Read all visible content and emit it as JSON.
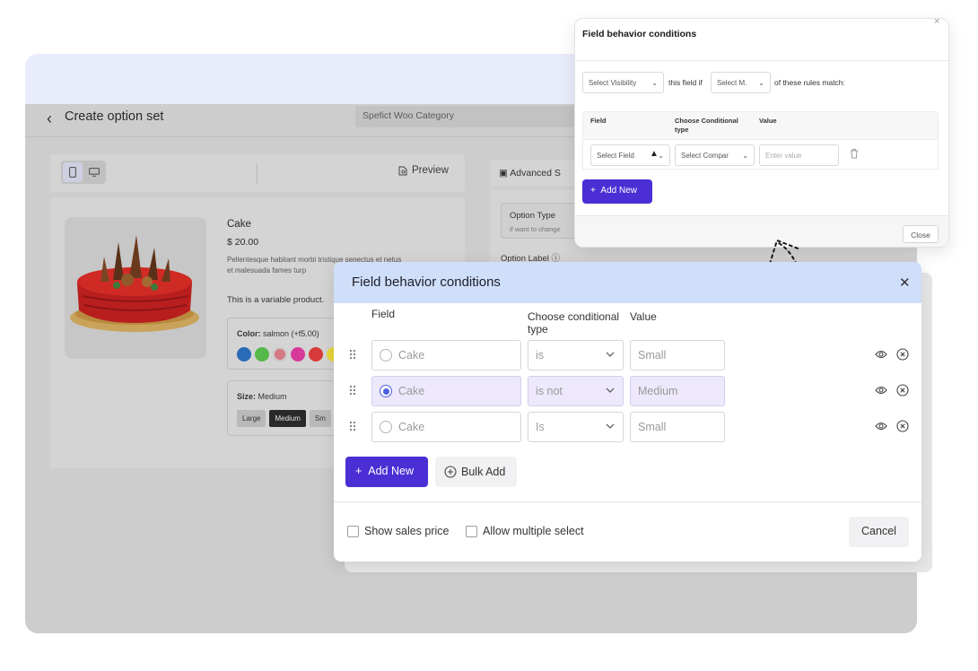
{
  "app": {
    "page_title": "Create option set",
    "category_value": "Spefict Woo Category",
    "preview_label": "Preview",
    "advanced_tab_label": "Advanced S",
    "option_type_label": "Option Type",
    "option_type_hint": "if want to change",
    "option_label": "Option Label"
  },
  "product": {
    "name": "Cake",
    "price": "$ 20.00",
    "description": "Pellentesque habitant morbi tristique senectus et netus et malesuada fames turp",
    "variable_note": "This is a variable product.",
    "color_label": "Color:",
    "color_value": "salmon (+f5.00)",
    "swatches": [
      "#2a6bb8",
      "#56b84a",
      "#d47884",
      "#d63a99",
      "#d63a3a",
      "#e7d63a"
    ],
    "size_label": "Size:",
    "size_value": "Medium",
    "sizes": [
      "Large",
      "Medium",
      "Sm"
    ]
  },
  "small_modal": {
    "title": "Field behavior conditions",
    "visibility_placeholder": "Select Visibility",
    "this_field_if": "this field if",
    "match_placeholder": "Select M.",
    "rules_match": "of these rules match:",
    "columns": [
      "Field",
      "Choose Conditional type",
      "Value"
    ],
    "row": {
      "field": "Select Field",
      "type": "Select Compar",
      "value_placeholder": "Enter value"
    },
    "add_new": "Add New",
    "close": "Close"
  },
  "main_modal": {
    "title": "Field behavior conditions",
    "columns": {
      "field": "Field",
      "type": "Choose conditional type",
      "value": "Value"
    },
    "rows": [
      {
        "field": "Cake",
        "type": "is",
        "value": "Small",
        "selected": false
      },
      {
        "field": "Cake",
        "type": "is not",
        "value": "Medium",
        "selected": true
      },
      {
        "field": "Cake",
        "type": "Is",
        "value": "Small",
        "selected": false
      }
    ],
    "add_new": "Add New",
    "bulk_add": "Bulk Add",
    "show_sales_price": "Show sales price",
    "allow_multiple_select": "Allow multiple select",
    "cancel": "Cancel"
  },
  "colors": {
    "accent": "#4b2fd4",
    "modal_header": "#cfdffa",
    "highlight_row": "#ede8fb",
    "radio_on": "#4b5fe0"
  }
}
